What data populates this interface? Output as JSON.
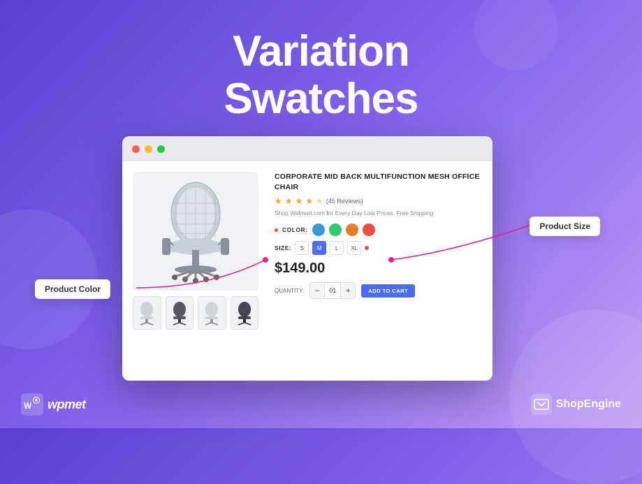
{
  "page": {
    "background_gradient_start": "#5b3fcf",
    "background_gradient_end": "#9b7af0"
  },
  "title": {
    "line1": "Variation",
    "line2": "Swatches"
  },
  "browser": {
    "dots": [
      "red",
      "yellow",
      "green"
    ]
  },
  "product": {
    "name": "CORPORATE MID BACK MULTIFUNCTION MESH OFFICE CHAIR",
    "rating": "4.5",
    "reviews": "(45 Reviews)",
    "description": "Shop Walmart.com for Every Day Low Prices. Free Shipping",
    "color_label": "COLOR:",
    "colors": [
      {
        "name": "blue",
        "hex": "#3498db"
      },
      {
        "name": "green",
        "hex": "#2ecc71"
      },
      {
        "name": "orange",
        "hex": "#e67e22"
      },
      {
        "name": "red",
        "hex": "#e74c3c"
      }
    ],
    "size_label": "SIZE:",
    "sizes": [
      {
        "label": "S",
        "active": false
      },
      {
        "label": "M",
        "active": true
      },
      {
        "label": "L",
        "active": false
      },
      {
        "label": "XL",
        "active": false
      }
    ],
    "price": "$149.00",
    "quantity_label": "QUANTITY:",
    "quantity_value": "01",
    "add_to_cart": "ADD TO CART"
  },
  "callouts": {
    "product_color": "Product Color",
    "product_size": "Product Size"
  },
  "footer": {
    "wpmet_label": "wpmet",
    "shopengine_label": "ShopEngine"
  }
}
